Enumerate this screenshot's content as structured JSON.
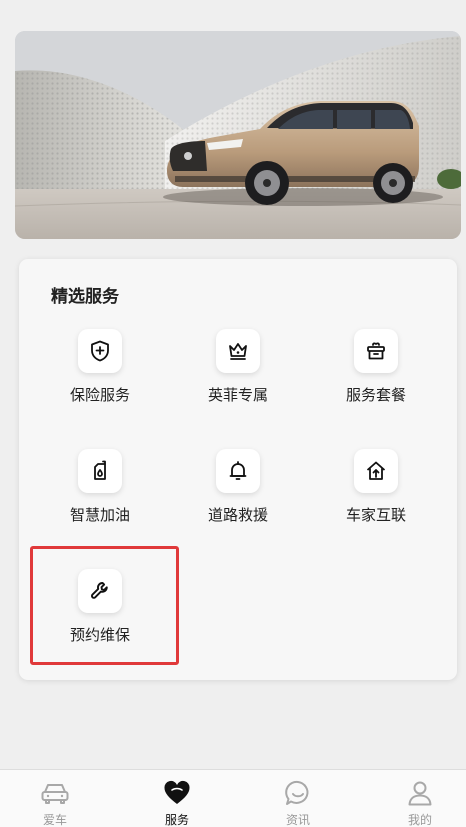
{
  "banner": {
    "image": "Infiniti QX60 SUV in champagne color in front of a curved perforated wall"
  },
  "services": {
    "title": "精选服务",
    "items": [
      {
        "label": "保险服务",
        "icon": "shield-plus-icon"
      },
      {
        "label": "英菲专属",
        "icon": "crown-icon"
      },
      {
        "label": "服务套餐",
        "icon": "gift-box-icon"
      },
      {
        "label": "智慧加油",
        "icon": "fuel-can-icon"
      },
      {
        "label": "道路救援",
        "icon": "bell-icon"
      },
      {
        "label": "车家互联",
        "icon": "home-arrow-icon"
      },
      {
        "label": "预约维保",
        "icon": "wrench-icon"
      }
    ],
    "highlighted": "预约维保"
  },
  "tabbar": {
    "tabs": [
      {
        "label": "爱车",
        "icon": "car-icon",
        "active": false
      },
      {
        "label": "服务",
        "icon": "heart-icon",
        "active": true
      },
      {
        "label": "资讯",
        "icon": "chat-bubble-icon",
        "active": false
      },
      {
        "label": "我的",
        "icon": "user-icon",
        "active": false
      }
    ]
  },
  "colors": {
    "highlight_border": "#e0393a",
    "active_tab": "#111111",
    "inactive_tab": "#999999"
  }
}
